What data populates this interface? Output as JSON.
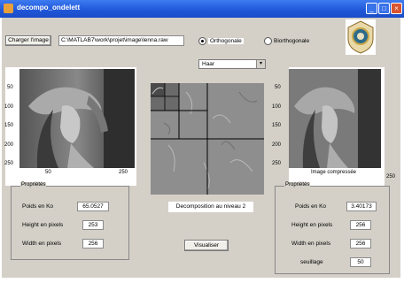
{
  "window": {
    "title": "decompo_ondelett"
  },
  "toolbar": {
    "load_label": "Charger l'image",
    "path_value": "C:\\MATLAB7\\work\\projet\\image\\lenna.raw",
    "orthogonal_label": "Orthogonale",
    "biorthogonal_label": "Biorthogonale",
    "wavelet_selected": "Haar"
  },
  "left_axes": {
    "y_ticks": [
      "50",
      "100",
      "150",
      "200",
      "250"
    ],
    "x_ticks": [
      "50",
      "250"
    ]
  },
  "right_axes": {
    "y_ticks": [
      "50",
      "100",
      "150",
      "200",
      "250"
    ],
    "x_tick_last": "250",
    "caption": "Image compressée"
  },
  "center": {
    "caption": "Decomposition au niveau 2"
  },
  "left_props": {
    "title": "Propriétés",
    "size_label": "Poids en Ko",
    "size_value": "65.0527",
    "height_label": "Height en pixels",
    "height_value": "253",
    "width_label": "Width en pixels",
    "width_value": "256"
  },
  "right_props": {
    "title": "Propriétés",
    "size_label": "Poids en Ko",
    "size_value": "3.40173",
    "height_label": "Height en pixels",
    "height_value": "256",
    "width_label": "Width en pixels",
    "width_value": "256",
    "threshold_label": "seuillage",
    "threshold_value": "50"
  },
  "visualize_label": "Visualiser",
  "colors": {
    "titlebar": "#1f56d8",
    "panel_bg": "#d4d0c8",
    "close": "#d9542f"
  },
  "icons": [
    "app-icon",
    "minimize-icon",
    "maximize-icon",
    "close-icon",
    "emblem-logo"
  ]
}
